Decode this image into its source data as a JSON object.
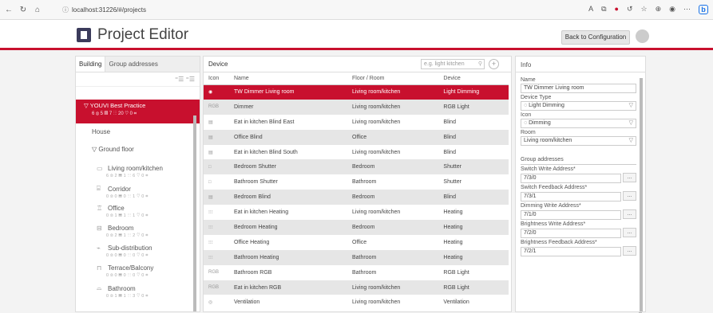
{
  "browser": {
    "url": "localhost:31226/#/projects"
  },
  "header": {
    "title": "Project Editor",
    "back_label": "Back to Configuration"
  },
  "left": {
    "tabs": [
      "Building",
      "Group addresses"
    ],
    "root": {
      "label": "YOUVI Best Practice",
      "stats": "6 ⦻  5 ▤  7 ⁝⁝⁝  20 ♡  0 ⌗"
    },
    "house": "House",
    "floor": "Ground floor",
    "rooms": [
      {
        "name": "Living room/kitchen",
        "icon": "▭",
        "stats": "6 ⦻   2 ▤   1 ⁝⁝⁝   6 ♡   0 ⌗"
      },
      {
        "name": "Corridor",
        "icon": "⌸",
        "stats": "0 ⦻   0 ▤   0 ⁝⁝⁝   1 ♡   0 ⌗"
      },
      {
        "name": "Office",
        "icon": "♖",
        "stats": "0 ⦻   1 ▤   1 ⁝⁝⁝   1 ♡   0 ⌗"
      },
      {
        "name": "Bedroom",
        "icon": "⊟",
        "stats": "0 ⦻   2 ▤   1 ⁝⁝⁝   2 ♡   0 ⌗"
      },
      {
        "name": "Sub-distribution",
        "icon": "⌁",
        "stats": "0 ⦻   0 ▤   0 ⁝⁝⁝   0 ♡   0 ⌗"
      },
      {
        "name": "Terrace/Balcony",
        "icon": "⊓",
        "stats": "0 ⦻   0 ▤   0 ⁝⁝⁝   0 ♡   0 ⌗"
      },
      {
        "name": "Bathroom",
        "icon": "⌓",
        "stats": "0 ⦻   1 ▤   1 ⁝⁝⁝   3 ♡   0 ⌗"
      }
    ]
  },
  "center": {
    "title": "Device",
    "search_placeholder": "e.g. light kitchen",
    "columns": [
      "Icon",
      "Name",
      "Floor / Room",
      "Device"
    ],
    "rows": [
      {
        "icon": "◉",
        "name": "TW Dimmer Living room",
        "room": "Living room/kitchen",
        "device": "Light Dimming",
        "state": "sel"
      },
      {
        "icon": "RGB",
        "name": "Dimmer",
        "room": "Living room/kitchen",
        "device": "RGB Light",
        "state": "alt"
      },
      {
        "icon": "▤",
        "name": "Eat in kitchen Blind East",
        "room": "Living room/kitchen",
        "device": "Blind",
        "state": ""
      },
      {
        "icon": "▤",
        "name": "Office Blind",
        "room": "Office",
        "device": "Blind",
        "state": "alt"
      },
      {
        "icon": "▤",
        "name": "Eat in kitchen Blind South",
        "room": "Living room/kitchen",
        "device": "Blind",
        "state": ""
      },
      {
        "icon": "□",
        "name": "Bedroom Shutter",
        "room": "Bedroom",
        "device": "Shutter",
        "state": "alt"
      },
      {
        "icon": "□",
        "name": "Bathroom Shutter",
        "room": "Bathroom",
        "device": "Shutter",
        "state": ""
      },
      {
        "icon": "▤",
        "name": "Bedroom Blind",
        "room": "Bedroom",
        "device": "Blind",
        "state": "alt"
      },
      {
        "icon": "⁝⁝⁝",
        "name": "Eat in kitchen Heating",
        "room": "Living room/kitchen",
        "device": "Heating",
        "state": ""
      },
      {
        "icon": "⁝⁝⁝",
        "name": "Bedroom Heating",
        "room": "Bedroom",
        "device": "Heating",
        "state": "alt"
      },
      {
        "icon": "⁝⁝⁝",
        "name": "Office Heating",
        "room": "Office",
        "device": "Heating",
        "state": ""
      },
      {
        "icon": "⁝⁝⁝",
        "name": "Bathroom Heating",
        "room": "Bathroom",
        "device": "Heating",
        "state": "alt"
      },
      {
        "icon": "RGB",
        "name": "Bathroom RGB",
        "room": "Bathroom",
        "device": "RGB Light",
        "state": ""
      },
      {
        "icon": "RGB",
        "name": "Eat in kitchen RGB",
        "room": "Living room/kitchen",
        "device": "RGB Light",
        "state": "alt"
      },
      {
        "icon": "◎",
        "name": "Ventilation",
        "room": "Living room/kitchen",
        "device": "Ventilation",
        "state": ""
      }
    ]
  },
  "info": {
    "title": "Info",
    "name_label": "Name",
    "name_value": "TW Dimmer Living room",
    "type_label": "Device Type",
    "type_value": "Light Dimming",
    "icon_label": "Icon",
    "icon_value": "Dimming",
    "room_label": "Room",
    "room_value": "Living room/kitchen",
    "group_title": "Group addresses",
    "addresses": [
      {
        "label": "Switch Write Address*",
        "value": "7/3/0"
      },
      {
        "label": "Switch Feedback Address*",
        "value": "7/3/1"
      },
      {
        "label": "Dimming Write Address*",
        "value": "7/1/0"
      },
      {
        "label": "Brightness Write Address*",
        "value": "7/2/0"
      },
      {
        "label": "Brightness Feedback Address*",
        "value": "7/2/1"
      }
    ],
    "dots": "..."
  }
}
